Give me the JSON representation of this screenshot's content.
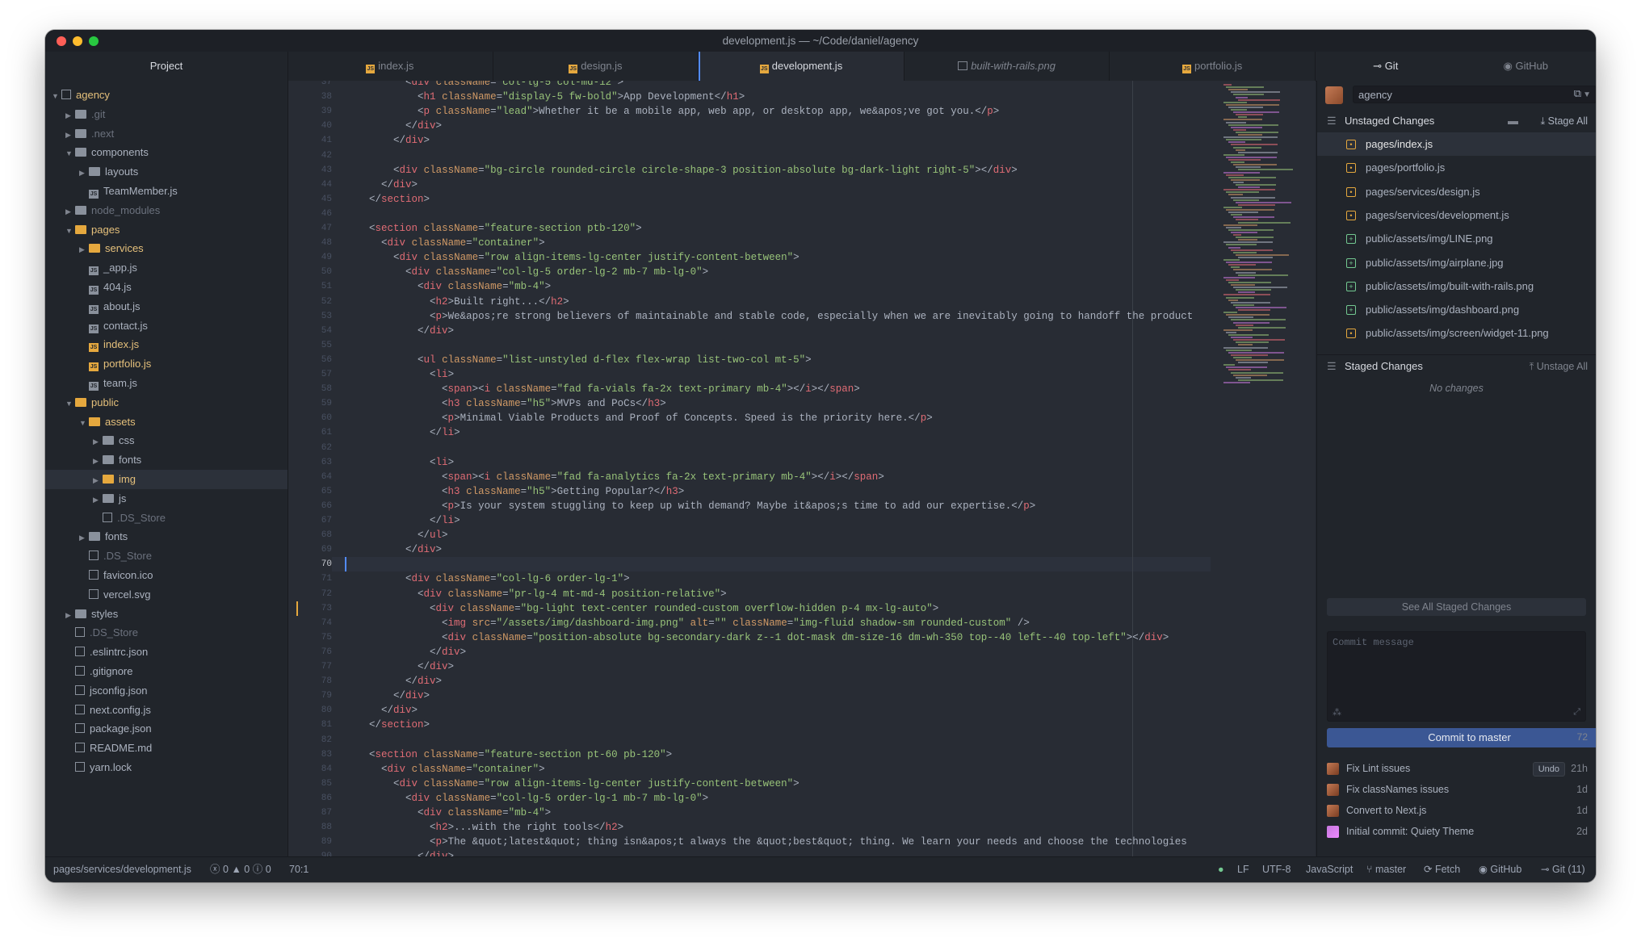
{
  "window": {
    "title": "development.js — ~/Code/daniel/agency",
    "lights": [
      "#ff5f57",
      "#febc2e",
      "#28c840"
    ]
  },
  "sidebar": {
    "title": "Project",
    "tree": [
      {
        "label": "agency",
        "depth": 0,
        "type": "root",
        "open": true,
        "hl": false
      },
      {
        "label": ".git",
        "depth": 1,
        "type": "folder",
        "open": false,
        "dim": true
      },
      {
        "label": ".next",
        "depth": 1,
        "type": "folder",
        "open": false,
        "dim": true
      },
      {
        "label": "components",
        "depth": 1,
        "type": "folder",
        "open": true
      },
      {
        "label": "layouts",
        "depth": 2,
        "type": "folder",
        "open": false
      },
      {
        "label": "TeamMember.js",
        "depth": 2,
        "type": "js"
      },
      {
        "label": "node_modules",
        "depth": 1,
        "type": "folder",
        "open": false,
        "dim": true
      },
      {
        "label": "pages",
        "depth": 1,
        "type": "folder",
        "open": true,
        "hl": true
      },
      {
        "label": "services",
        "depth": 2,
        "type": "folder",
        "open": false,
        "hl": true
      },
      {
        "label": "_app.js",
        "depth": 2,
        "type": "js"
      },
      {
        "label": "404.js",
        "depth": 2,
        "type": "js"
      },
      {
        "label": "about.js",
        "depth": 2,
        "type": "js"
      },
      {
        "label": "contact.js",
        "depth": 2,
        "type": "js"
      },
      {
        "label": "index.js",
        "depth": 2,
        "type": "js",
        "hl": true
      },
      {
        "label": "portfolio.js",
        "depth": 2,
        "type": "js",
        "hl": true
      },
      {
        "label": "team.js",
        "depth": 2,
        "type": "js"
      },
      {
        "label": "public",
        "depth": 1,
        "type": "folder",
        "open": true,
        "hl": true
      },
      {
        "label": "assets",
        "depth": 2,
        "type": "folder",
        "open": true,
        "hl": true
      },
      {
        "label": "css",
        "depth": 3,
        "type": "folder",
        "open": false
      },
      {
        "label": "fonts",
        "depth": 3,
        "type": "folder",
        "open": false
      },
      {
        "label": "img",
        "depth": 3,
        "type": "folder",
        "open": false,
        "hl": true,
        "selected": true
      },
      {
        "label": "js",
        "depth": 3,
        "type": "folder",
        "open": false
      },
      {
        "label": ".DS_Store",
        "depth": 3,
        "type": "file",
        "dim": true
      },
      {
        "label": "fonts",
        "depth": 2,
        "type": "folder",
        "open": false
      },
      {
        "label": ".DS_Store",
        "depth": 2,
        "type": "file",
        "dim": true
      },
      {
        "label": "favicon.ico",
        "depth": 2,
        "type": "file"
      },
      {
        "label": "vercel.svg",
        "depth": 2,
        "type": "file"
      },
      {
        "label": "styles",
        "depth": 1,
        "type": "folder",
        "open": false
      },
      {
        "label": ".DS_Store",
        "depth": 1,
        "type": "file",
        "dim": true
      },
      {
        "label": ".eslintrc.json",
        "depth": 1,
        "type": "file"
      },
      {
        "label": ".gitignore",
        "depth": 1,
        "type": "file"
      },
      {
        "label": "jsconfig.json",
        "depth": 1,
        "type": "file"
      },
      {
        "label": "next.config.js",
        "depth": 1,
        "type": "file"
      },
      {
        "label": "package.json",
        "depth": 1,
        "type": "file"
      },
      {
        "label": "README.md",
        "depth": 1,
        "type": "file"
      },
      {
        "label": "yarn.lock",
        "depth": 1,
        "type": "file"
      }
    ]
  },
  "tabs": [
    {
      "label": "index.js",
      "kind": "js",
      "active": false
    },
    {
      "label": "design.js",
      "kind": "js",
      "active": false
    },
    {
      "label": "development.js",
      "kind": "js",
      "active": true
    },
    {
      "label": "built-with-rails.png",
      "kind": "img",
      "active": false,
      "italic": true
    },
    {
      "label": "portfolio.js",
      "kind": "js",
      "active": false
    }
  ],
  "right_tabs": [
    {
      "label": "Git",
      "icon": "git-commit-icon",
      "active": true
    },
    {
      "label": "GitHub",
      "icon": "github-icon",
      "active": false
    }
  ],
  "editor": {
    "first_line": 37,
    "current_line": 70,
    "modified_line": 73,
    "lines": [
      "          <div className=\"col-lg-5 col-md-12\">",
      "            <h1 className=\"display-5 fw-bold\">App Development</h1>",
      "            <p className=\"lead\">Whether it be a mobile app, web app, or desktop app, we&apos;ve got you.</p>",
      "          </div>",
      "        </div>",
      "",
      "        <div className=\"bg-circle rounded-circle circle-shape-3 position-absolute bg-dark-light right-5\"></div>",
      "      </div>",
      "    </section>",
      "",
      "    <section className=\"feature-section ptb-120\">",
      "      <div className=\"container\">",
      "        <div className=\"row align-items-lg-center justify-content-between\">",
      "          <div className=\"col-lg-5 order-lg-2 mb-7 mb-lg-0\">",
      "            <div className=\"mb-4\">",
      "              <h2>Built right...</h2>",
      "              <p>We&apos;re strong believers of maintainable and stable code, especially when we are inevitably going to handoff the product",
      "            </div>",
      "",
      "            <ul className=\"list-unstyled d-flex flex-wrap list-two-col mt-5\">",
      "              <li>",
      "                <span><i className=\"fad fa-vials fa-2x text-primary mb-4\"></i></span>",
      "                <h3 className=\"h5\">MVPs and PoCs</h3>",
      "                <p>Minimal Viable Products and Proof of Concepts. Speed is the priority here.</p>",
      "              </li>",
      "",
      "              <li>",
      "                <span><i className=\"fad fa-analytics fa-2x text-primary mb-4\"></i></span>",
      "                <h3 className=\"h5\">Getting Popular?</h3>",
      "                <p>Is your system stuggling to keep up with demand? Maybe it&apos;s time to add our expertise.</p>",
      "              </li>",
      "            </ul>",
      "          </div>",
      "",
      "          <div className=\"col-lg-6 order-lg-1\">",
      "            <div className=\"pr-lg-4 mt-md-4 position-relative\">",
      "              <div className=\"bg-light text-center rounded-custom overflow-hidden p-4 mx-lg-auto\">",
      "                <img src=\"/assets/img/dashboard-img.png\" alt=\"\" className=\"img-fluid shadow-sm rounded-custom\" />",
      "                <div className=\"position-absolute bg-secondary-dark z--1 dot-mask dm-size-16 dm-wh-350 top--40 left--40 top-left\"></div>",
      "              </div>",
      "            </div>",
      "          </div>",
      "        </div>",
      "      </div>",
      "    </section>",
      "",
      "    <section className=\"feature-section pt-60 pb-120\">",
      "      <div className=\"container\">",
      "        <div className=\"row align-items-lg-center justify-content-between\">",
      "          <div className=\"col-lg-5 order-lg-1 mb-7 mb-lg-0\">",
      "            <div className=\"mb-4\">",
      "              <h2>...with the right tools</h2>",
      "              <p>The &quot;latest&quot; thing isn&apos;t always the &quot;best&quot; thing. We learn your needs and choose the technologies",
      "            </div>",
      ""
    ]
  },
  "git": {
    "repo": "agency",
    "unstaged_title": "Unstaged Changes",
    "stage_all": "Stage All",
    "unstaged": [
      {
        "path": "pages/index.js",
        "status": "modified",
        "selected": true
      },
      {
        "path": "pages/portfolio.js",
        "status": "modified"
      },
      {
        "path": "pages/services/design.js",
        "status": "modified"
      },
      {
        "path": "pages/services/development.js",
        "status": "modified"
      },
      {
        "path": "public/assets/img/LINE.png",
        "status": "added"
      },
      {
        "path": "public/assets/img/airplane.jpg",
        "status": "added"
      },
      {
        "path": "public/assets/img/built-with-rails.png",
        "status": "added"
      },
      {
        "path": "public/assets/img/dashboard.png",
        "status": "added"
      },
      {
        "path": "public/assets/img/screen/widget-11.png",
        "status": "modified"
      }
    ],
    "staged_title": "Staged Changes",
    "unstage_all": "Unstage All",
    "no_changes": "No changes",
    "see_all": "See All Staged Changes",
    "commit_placeholder": "Commit message",
    "commit_button": "Commit to master",
    "char_count": "72",
    "undo": "Undo",
    "history": [
      {
        "message": "Fix Lint issues",
        "when": "21h",
        "undo": true
      },
      {
        "message": "Fix classNames issues",
        "when": "1d"
      },
      {
        "message": "Convert to Next.js",
        "when": "1d"
      },
      {
        "message": "Initial commit: Quiety Theme",
        "when": "2d",
        "pink": true
      }
    ]
  },
  "status": {
    "path": "pages/services/development.js",
    "errors": "0",
    "warnings": "0",
    "infos": "0",
    "cursor": "70:1",
    "line_ending": "LF",
    "encoding": "UTF-8",
    "grammar": "JavaScript",
    "branch": "master",
    "fetch": "Fetch",
    "github": "GitHub",
    "git": "Git (11)"
  }
}
